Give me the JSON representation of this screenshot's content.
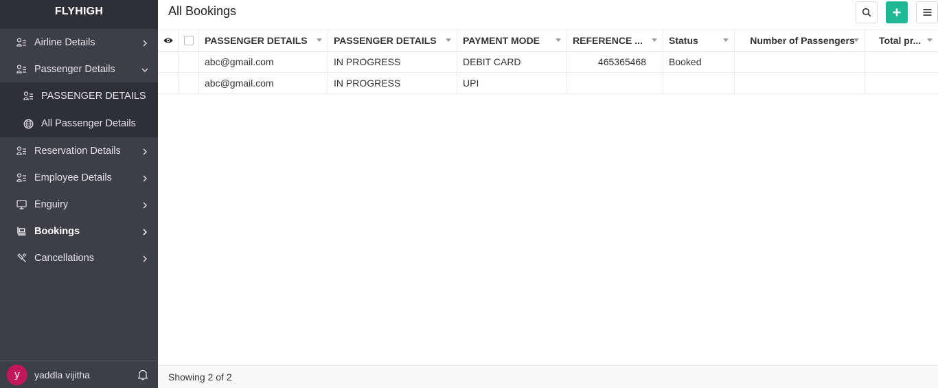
{
  "app": {
    "brand": "FLYHIGH"
  },
  "sidebar": {
    "items": [
      {
        "label": "Airline Details",
        "icon": "user-list-icon"
      },
      {
        "label": "Passenger Details",
        "icon": "user-list-icon",
        "expanded": true,
        "children": [
          {
            "label": "PASSENGER DETAILS",
            "icon": "user-list-icon"
          },
          {
            "label": "All Passenger Details",
            "icon": "globe-icon"
          }
        ]
      },
      {
        "label": "Reservation Details",
        "icon": "user-list-icon"
      },
      {
        "label": "Employee Details",
        "icon": "user-list-icon"
      },
      {
        "label": "Enguiry",
        "icon": "monitor-icon"
      },
      {
        "label": "Bookings",
        "icon": "booking-icon",
        "active": true
      },
      {
        "label": "Cancellations",
        "icon": "cancel-tool-icon"
      }
    ]
  },
  "user": {
    "initial": "y",
    "name": "yaddla vijitha"
  },
  "page": {
    "title": "All Bookings"
  },
  "table": {
    "columns": [
      "PASSENGER DETAILS",
      "PASSENGER DETAILS",
      "PAYMENT MODE",
      "REFERENCE ...",
      "Status",
      "Number of Passengers",
      "Total pr..."
    ],
    "rows": [
      [
        "abc@gmail.com",
        "IN PROGRESS",
        "DEBIT CARD",
        "465365468",
        "Booked",
        "",
        ""
      ],
      [
        "abc@gmail.com",
        "IN PROGRESS",
        "UPI",
        "",
        "",
        "",
        ""
      ]
    ]
  },
  "footer": {
    "status": "Showing 2 of 2"
  },
  "colors": {
    "sidebar_bg": "#3e3e46",
    "sidebar_dark": "#2f2f36",
    "accent": "#1fb794",
    "avatar": "#c2185b"
  }
}
